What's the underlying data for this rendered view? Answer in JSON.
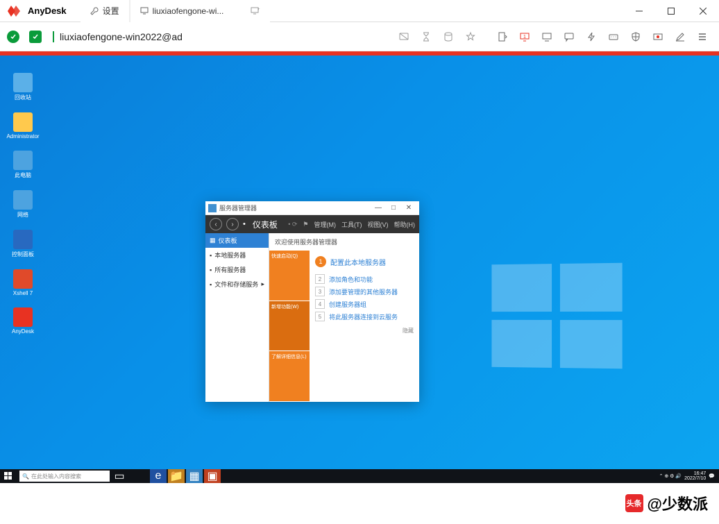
{
  "titlebar": {
    "app_name": "AnyDesk",
    "settings_tab": "设置",
    "session_tab": "liuxiaofengone-wi..."
  },
  "toolbar": {
    "address": "liuxiaofengone-win2022@ad"
  },
  "desktop_icons": [
    {
      "label": "回收站",
      "cls": "recycle"
    },
    {
      "label": "Administrator",
      "cls": "folder"
    },
    {
      "label": "此电脑",
      "cls": "computer"
    },
    {
      "label": "网络",
      "cls": "network"
    },
    {
      "label": "控制面板",
      "cls": "control"
    },
    {
      "label": "Xshell 7",
      "cls": "xshell"
    },
    {
      "label": "AnyDesk",
      "cls": "anydesk-remote"
    }
  ],
  "server_manager": {
    "window_title": "服务器管理器",
    "dashboard": "仪表板",
    "menu": {
      "refresh": "⟳",
      "manage": "管理(M)",
      "tools": "工具(T)",
      "view": "视图(V)",
      "help": "帮助(H)"
    },
    "sidebar": [
      "仪表板",
      "本地服务器",
      "所有服务器",
      "文件和存储服务"
    ],
    "welcome": "欢迎使用服务器管理器",
    "orange_tiles": [
      "快速启动(Q)",
      "新增功能(W)",
      "了解详细信息(L)"
    ],
    "step_main": "配置此本地服务器",
    "steps": [
      "添加角色和功能",
      "添加要管理的其他服务器",
      "创建服务器组",
      "将此服务器连接到云服务"
    ],
    "hide": "隐藏"
  },
  "taskbar": {
    "search_placeholder": "在此处输入内容搜索",
    "time": "16:47",
    "date": "2022/7/10"
  },
  "watermark": {
    "badge": "头条",
    "text": "@少数派"
  }
}
